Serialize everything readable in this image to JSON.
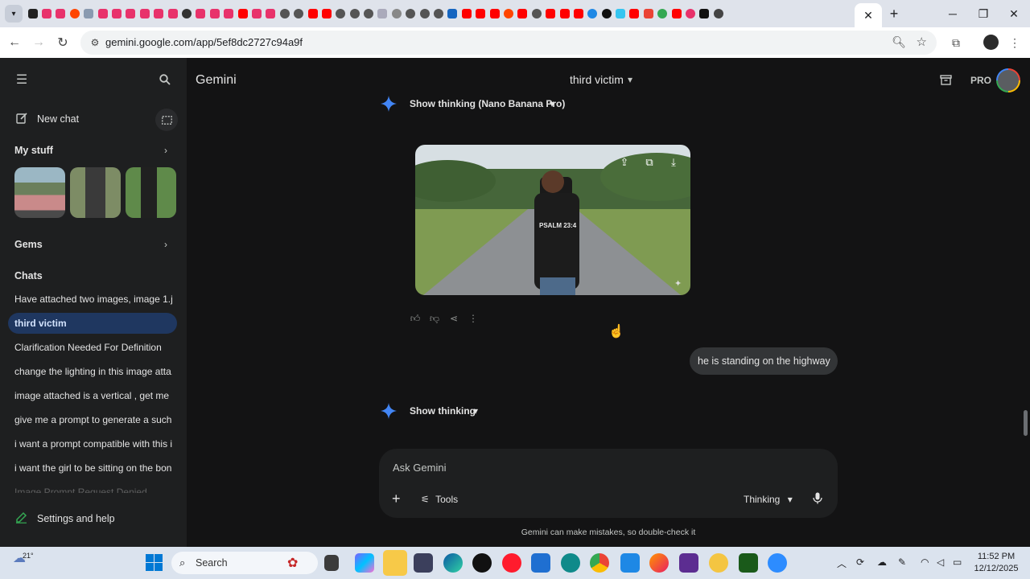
{
  "browser": {
    "url": "gemini.google.com/app/5ef8dc2727c94a9f",
    "active_tab_close": "✕",
    "new_tab": "+"
  },
  "sidebar": {
    "new_chat": "New chat",
    "my_stuff": "My stuff",
    "gems": "Gems",
    "chats_heading": "Chats",
    "chats": [
      {
        "label": "Have attached two images, image 1.jp..."
      },
      {
        "label": "third victim"
      },
      {
        "label": "Clarification Needed For Definition"
      },
      {
        "label": "change the lighting in this image atta..."
      },
      {
        "label": "image attached is a vertical , get me ..."
      },
      {
        "label": "give me a prompt to generate a such ..."
      },
      {
        "label": "i want a prompt compatible with this i..."
      },
      {
        "label": "i want the girl to be sitting on the bon..."
      },
      {
        "label": "Image Prompt Request Denied"
      }
    ],
    "settings": "Settings and help"
  },
  "header": {
    "app_title": "Gemini",
    "conversation_title": "third victim",
    "pro_badge": "PRO"
  },
  "conversation": {
    "thinking_1": "Show thinking (Nano Banana Pro)",
    "image_shirt_text": "PSALM 23:4",
    "user_message": "he is standing on the highway",
    "thinking_2": "Show thinking"
  },
  "composer": {
    "placeholder": "Ask Gemini",
    "tools": "Tools",
    "mode": "Thinking",
    "disclaimer": "Gemini can make mistakes, so double-check it"
  },
  "taskbar": {
    "weather": "21°",
    "search": "Search",
    "time": "11:52 PM",
    "date": "12/12/2025"
  }
}
